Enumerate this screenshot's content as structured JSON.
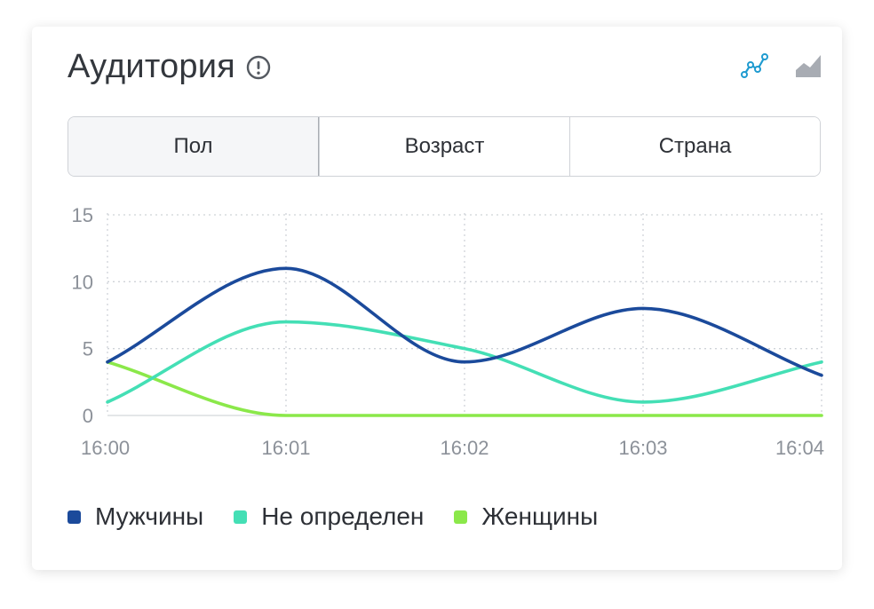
{
  "card": {
    "title": "Аудитория"
  },
  "tabs": [
    {
      "label": "Пол",
      "active": true
    },
    {
      "label": "Возраст",
      "active": false
    },
    {
      "label": "Страна",
      "active": false
    }
  ],
  "colors": {
    "men": "#1b4a9b",
    "undefined": "#44dfb5",
    "women": "#8be84a",
    "accent_icon": "#1f9bd0",
    "inactive_icon": "#a8acb3"
  },
  "icons": {
    "info": "info-circle-icon",
    "line_view": "line-chart-icon",
    "area_view": "area-chart-icon"
  },
  "chart_data": {
    "type": "line",
    "x": [
      "16:00",
      "16:01",
      "16:02",
      "16:03",
      "16:04"
    ],
    "ylim": [
      0,
      15
    ],
    "yticks": [
      0,
      5,
      10,
      15
    ],
    "grid": true,
    "legend_position": "bottom-left",
    "series": [
      {
        "name": "Мужчины",
        "color": "#1b4a9b",
        "values": [
          4,
          11,
          4,
          8,
          3
        ]
      },
      {
        "name": "Не определен",
        "color": "#44dfb5",
        "values": [
          1,
          7,
          5,
          1,
          4
        ]
      },
      {
        "name": "Женщины",
        "color": "#8be84a",
        "values": [
          4,
          0,
          0,
          0,
          0
        ]
      }
    ]
  }
}
